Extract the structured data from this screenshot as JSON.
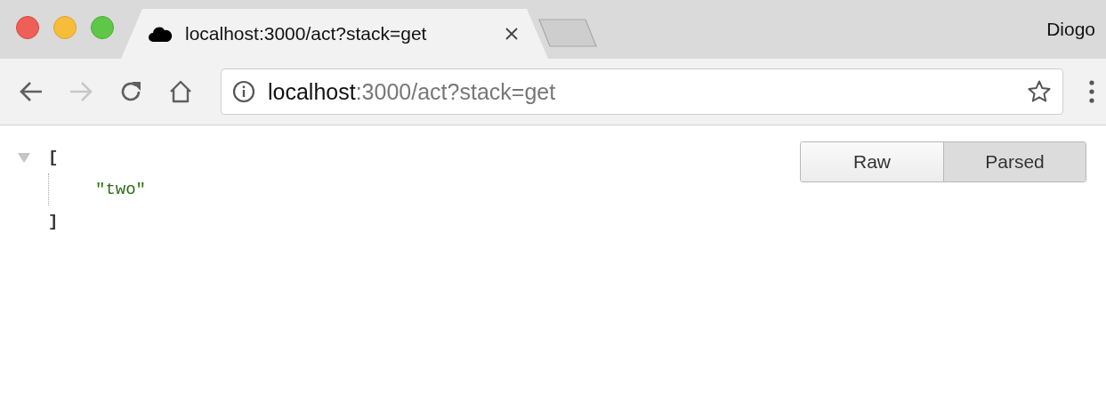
{
  "window": {
    "user": "Diogo"
  },
  "tabs": [
    {
      "title": "localhost:3000/act?stack=get",
      "selected": true
    }
  ],
  "toolbar": {
    "nav_buttons": [
      {
        "kind": "back",
        "disabled": false
      },
      {
        "kind": "forward",
        "disabled": true
      },
      {
        "kind": "reload",
        "disabled": false
      },
      {
        "kind": "home",
        "disabled": false
      }
    ],
    "address": {
      "host": "localhost",
      "path": ":3000/act?stack=get"
    }
  },
  "json_view": {
    "expanded": true,
    "open_bracket": "[",
    "items": [
      "\"two\""
    ],
    "close_bracket": "]"
  },
  "view_toggle": [
    {
      "label": "Raw",
      "selected": false
    },
    {
      "label": "Parsed",
      "selected": true
    }
  ]
}
